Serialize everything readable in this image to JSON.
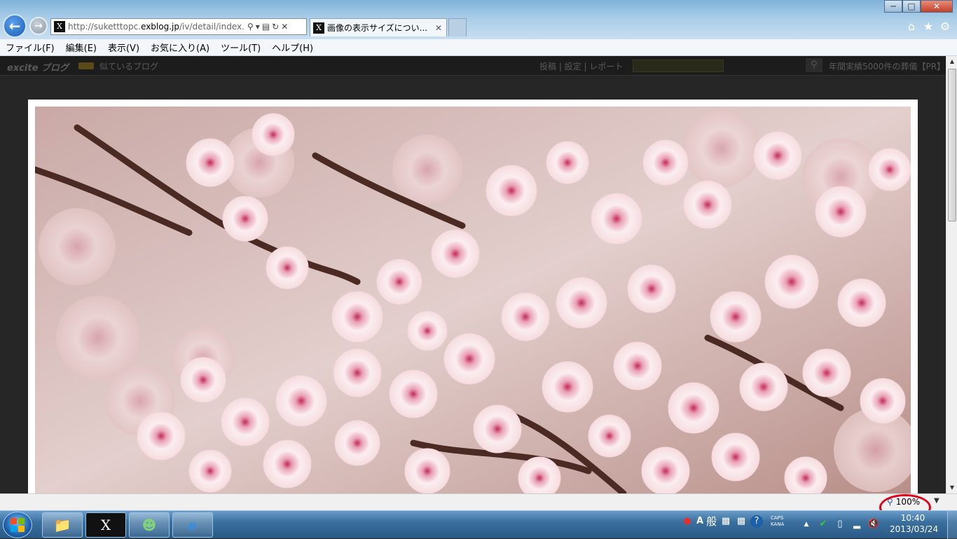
{
  "browser": {
    "address": {
      "url_prefix": "http://suketttopc.",
      "url_domain": "exblog.jp",
      "url_rest": "/iv/detail/index.a"
    },
    "favicon_letter": "X",
    "tabs": [
      {
        "label": "画像の表示サイズについ...",
        "active": true
      }
    ],
    "menu": [
      "ファイル(F)",
      "編集(E)",
      "表示(V)",
      "お気に入り(A)",
      "ツール(T)",
      "ヘルプ(H)"
    ]
  },
  "page": {
    "logo": "excite ブログ",
    "similar_blogs": "似ているブログ",
    "header_links": "投稿 | 設定 | レポート",
    "pr_text": "年間実績5000件の葬儀【PR】"
  },
  "statusbar": {
    "zoom": "100%"
  },
  "taskbar": {
    "ime_mode": "A",
    "ime_kanji": "般",
    "caps": "CAPS",
    "kana": "KANA",
    "time": "10:40",
    "date": "2013/03/24"
  },
  "colors": {
    "accent": "#1a5cb8",
    "highlight": "#e0001a",
    "page_bg": "#262626"
  }
}
